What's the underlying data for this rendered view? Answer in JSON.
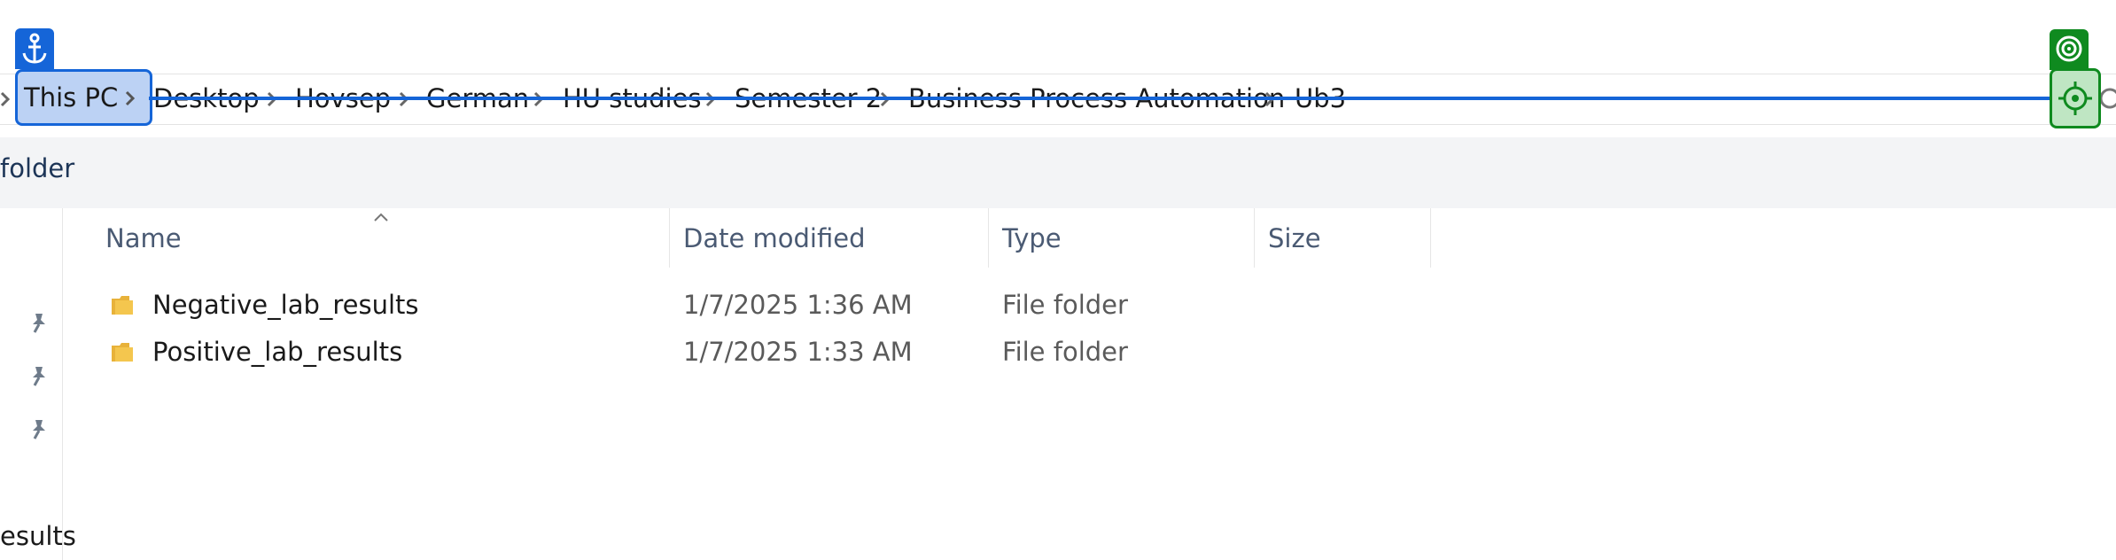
{
  "breadcrumb": {
    "items": [
      {
        "label": "This PC"
      },
      {
        "label": "Desktop"
      },
      {
        "label": "Hovsep"
      },
      {
        "label": "German"
      },
      {
        "label": "HU studies"
      },
      {
        "label": "Semester 2"
      },
      {
        "label": "Business Process Automation"
      },
      {
        "label": "Ub3"
      }
    ]
  },
  "command_bar": {
    "text": "folder"
  },
  "nav_pane": {
    "visible_text": "esults"
  },
  "columns": {
    "name": "Name",
    "date_modified": "Date modified",
    "type": "Type",
    "size": "Size"
  },
  "files": [
    {
      "name": "Negative_lab_results",
      "date_modified": "1/7/2025 1:36 AM",
      "type": "File folder",
      "size": ""
    },
    {
      "name": "Positive_lab_results",
      "date_modified": "1/7/2025 1:33 AM",
      "type": "File folder",
      "size": ""
    }
  ],
  "colors": {
    "selection_blue": "#1565d8",
    "selection_fill": "#bcd2f4",
    "target_green": "#0f8a1f",
    "target_fill": "#bfe6c3",
    "folder_yellow": "#f4c64e"
  },
  "icons": {
    "anchor": "anchor-icon",
    "target": "target-icon",
    "crosshair": "crosshair-icon",
    "chevron": "chevron-right-icon",
    "pin": "pin-icon",
    "folder": "folder-icon",
    "refresh": "refresh-icon",
    "sort": "sort-up-icon"
  }
}
